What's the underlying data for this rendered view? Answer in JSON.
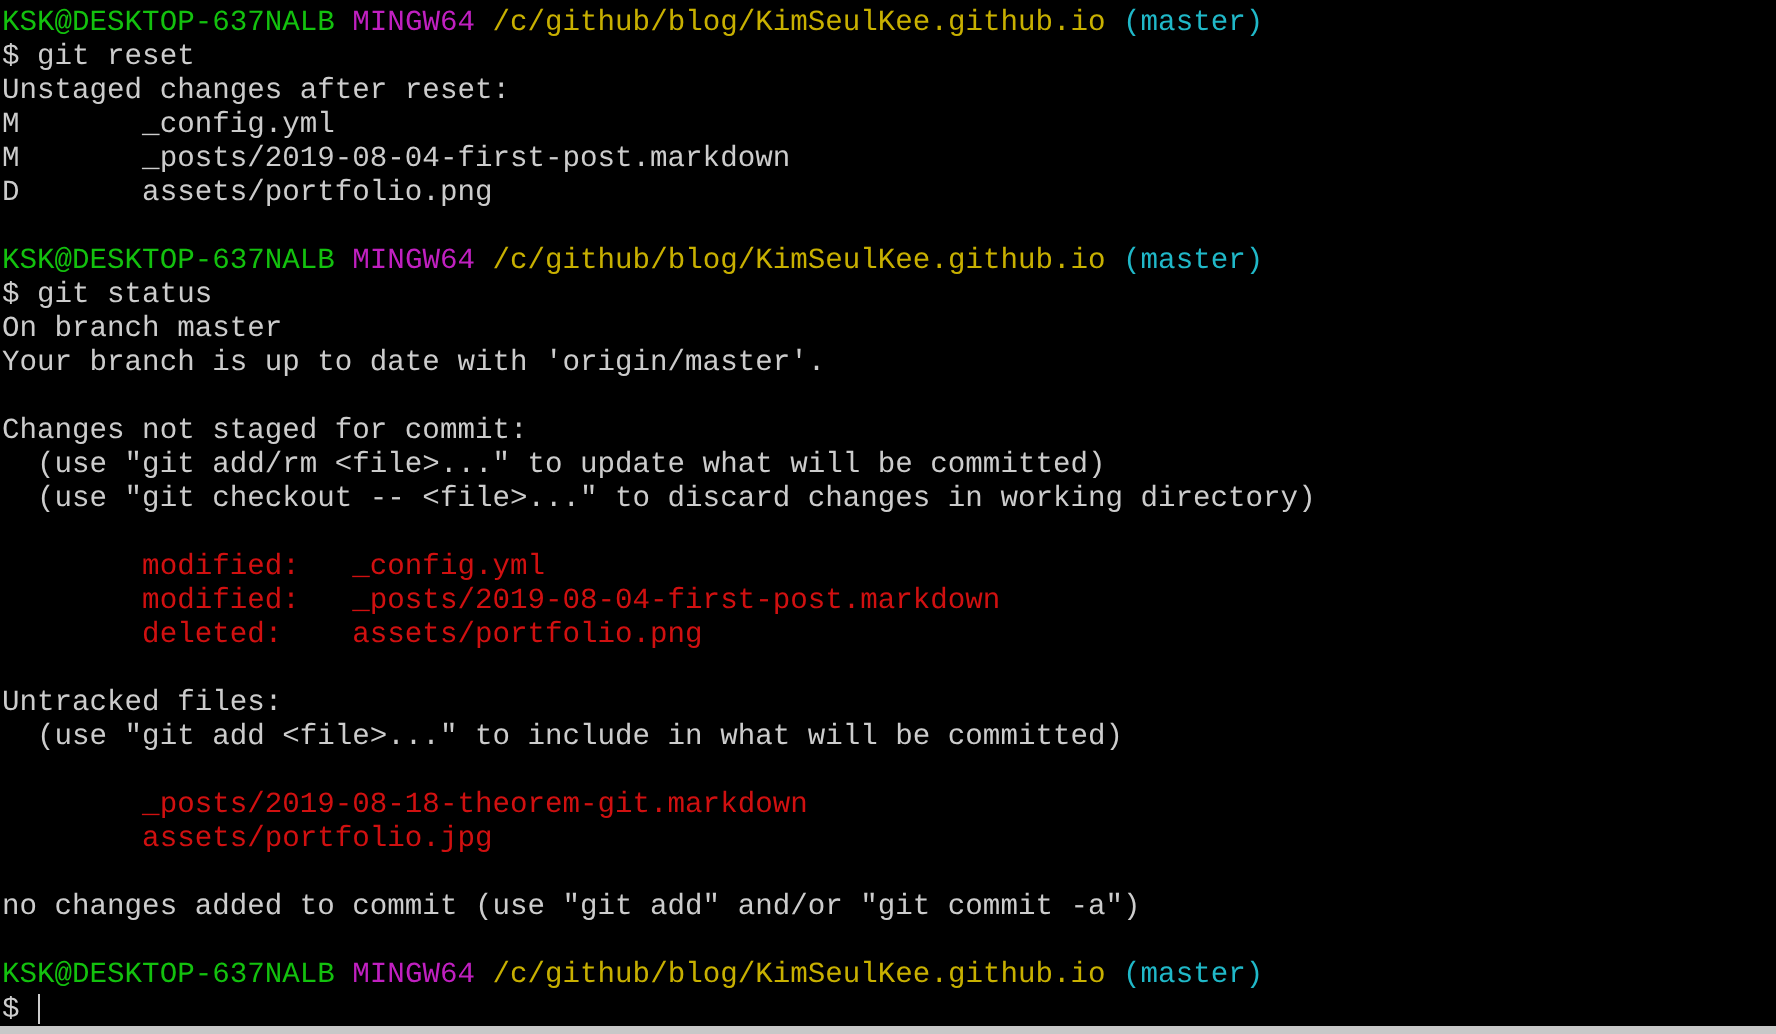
{
  "terminal": {
    "lines": [
      {
        "kind": "prompt",
        "user": "KSK@DESKTOP-637NALB",
        "shell": "MINGW64",
        "path": "/c/github/blog/KimSeulKee.github.io",
        "branch": "(master)"
      },
      {
        "kind": "command",
        "symbol": "$",
        "text": "git reset"
      },
      {
        "kind": "output",
        "text": "Unstaged changes after reset:"
      },
      {
        "kind": "output",
        "text": "M       _config.yml"
      },
      {
        "kind": "output",
        "text": "M       _posts/2019-08-04-first-post.markdown"
      },
      {
        "kind": "output",
        "text": "D       assets/portfolio.png"
      },
      {
        "kind": "blank"
      },
      {
        "kind": "prompt",
        "user": "KSK@DESKTOP-637NALB",
        "shell": "MINGW64",
        "path": "/c/github/blog/KimSeulKee.github.io",
        "branch": "(master)"
      },
      {
        "kind": "command",
        "symbol": "$",
        "text": "git status"
      },
      {
        "kind": "output",
        "text": "On branch master"
      },
      {
        "kind": "output",
        "text": "Your branch is up to date with 'origin/master'."
      },
      {
        "kind": "blank"
      },
      {
        "kind": "output",
        "text": "Changes not staged for commit:"
      },
      {
        "kind": "output",
        "text": "  (use \"git add/rm <file>...\" to update what will be committed)"
      },
      {
        "kind": "output",
        "text": "  (use \"git checkout -- <file>...\" to discard changes in working directory)"
      },
      {
        "kind": "blank"
      },
      {
        "kind": "error",
        "text": "        modified:   _config.yml"
      },
      {
        "kind": "error",
        "text": "        modified:   _posts/2019-08-04-first-post.markdown"
      },
      {
        "kind": "error",
        "text": "        deleted:    assets/portfolio.png"
      },
      {
        "kind": "blank"
      },
      {
        "kind": "output",
        "text": "Untracked files:"
      },
      {
        "kind": "output",
        "text": "  (use \"git add <file>...\" to include in what will be committed)"
      },
      {
        "kind": "blank"
      },
      {
        "kind": "error",
        "text": "        _posts/2019-08-18-theorem-git.markdown"
      },
      {
        "kind": "error",
        "text": "        assets/portfolio.jpg"
      },
      {
        "kind": "blank"
      },
      {
        "kind": "output",
        "text": "no changes added to commit (use \"git add\" and/or \"git commit -a\")"
      },
      {
        "kind": "blank"
      },
      {
        "kind": "prompt",
        "user": "KSK@DESKTOP-637NALB",
        "shell": "MINGW64",
        "path": "/c/github/blog/KimSeulKee.github.io",
        "branch": "(master)"
      },
      {
        "kind": "input",
        "symbol": "$"
      }
    ]
  }
}
